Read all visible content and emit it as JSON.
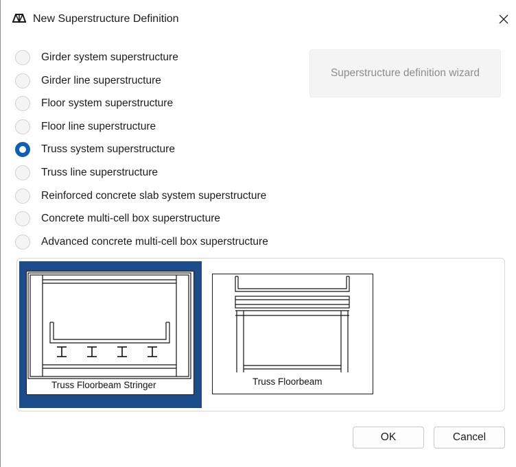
{
  "window": {
    "title": "New Superstructure Definition"
  },
  "options": [
    {
      "label": "Girder system superstructure",
      "checked": false
    },
    {
      "label": "Girder line superstructure",
      "checked": false
    },
    {
      "label": "Floor system superstructure",
      "checked": false
    },
    {
      "label": "Floor line superstructure",
      "checked": false
    },
    {
      "label": "Truss system superstructure",
      "checked": true
    },
    {
      "label": "Truss line superstructure",
      "checked": false
    },
    {
      "label": "Reinforced concrete slab system superstructure",
      "checked": false
    },
    {
      "label": "Concrete multi-cell box superstructure",
      "checked": false
    },
    {
      "label": "Advanced concrete multi-cell box superstructure",
      "checked": false
    }
  ],
  "wizard": {
    "label": "Superstructure definition wizard",
    "enabled": false
  },
  "types": [
    {
      "caption": "Truss Floorbeam Stringer",
      "selected": true
    },
    {
      "caption": "Truss Floorbeam",
      "selected": false
    }
  ],
  "buttons": {
    "ok": "OK",
    "cancel": "Cancel"
  },
  "colors": {
    "accent": "#0c5fb5",
    "selection": "#1d4c8c"
  },
  "icons": {
    "app": "truss-bridge-icon",
    "close": "close-icon"
  }
}
